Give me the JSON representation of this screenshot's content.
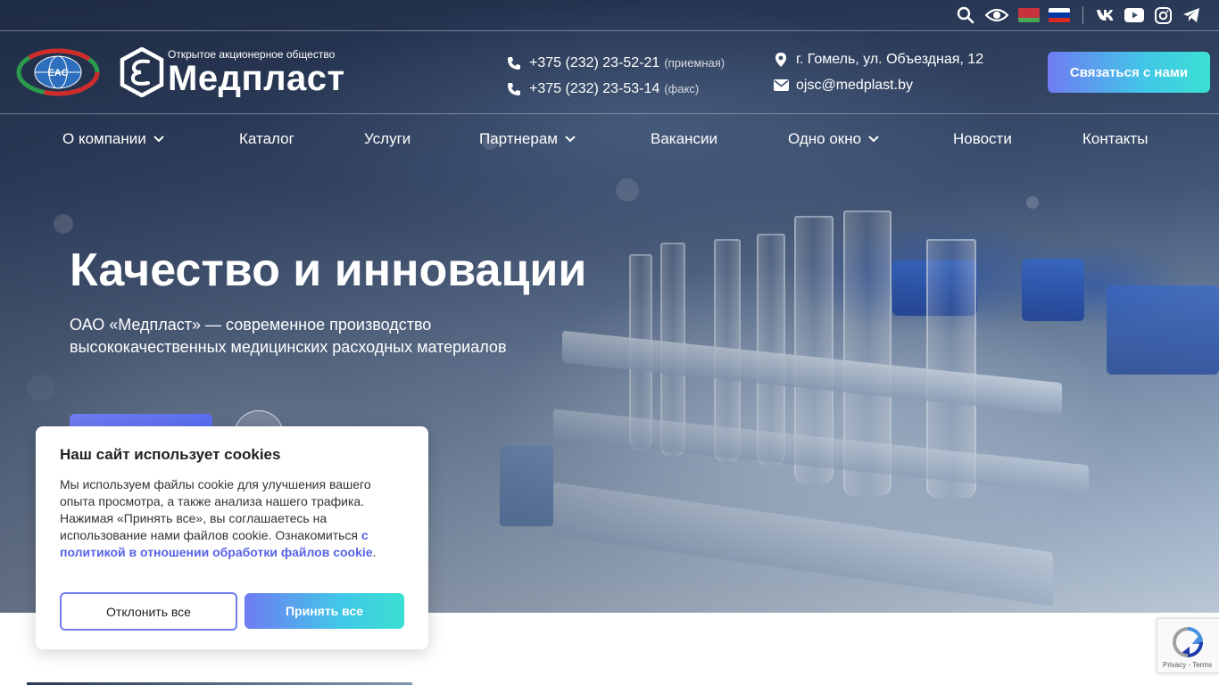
{
  "topbar": {
    "icons": [
      "search-icon",
      "eye-icon",
      "flag-by-icon",
      "flag-ru-icon",
      "vk-icon",
      "youtube-icon",
      "instagram-icon",
      "telegram-icon"
    ]
  },
  "header": {
    "eac_logo_text": "EAC",
    "brand_subtitle": "Открытое акционерное общество",
    "brand_name": "Медпласт",
    "phone1": "+375 (232) 23-52-21",
    "phone1_note": "(приемная)",
    "phone2": "+375 (232) 23-53-14",
    "phone2_note": "(факс)",
    "address": "г. Гомель, ул. Объездная, 12",
    "email": "ojsc@medplast.by",
    "cta_label": "Связаться с нами"
  },
  "nav": {
    "items": [
      {
        "label": "О компании",
        "has_dropdown": true
      },
      {
        "label": "Каталог",
        "has_dropdown": false
      },
      {
        "label": "Услуги",
        "has_dropdown": false
      },
      {
        "label": "Партнерам",
        "has_dropdown": true
      },
      {
        "label": "Вакансии",
        "has_dropdown": false
      },
      {
        "label": "Одно окно",
        "has_dropdown": true
      },
      {
        "label": "Новости",
        "has_dropdown": false
      },
      {
        "label": "Контакты",
        "has_dropdown": false
      }
    ]
  },
  "hero": {
    "title": "Качество и инновации",
    "subtitle": "ОАО «Медпласт» — современное производство высококачественных медицинских расходных материалов"
  },
  "cookie": {
    "title": "Наш сайт использует cookies",
    "text": "Мы используем файлы cookie для улучшения вашего опыта просмотра, а также анализа нашего трафика. Нажимая «Принять все», вы соглашаетесь на использование нами файлов cookie. Ознакомиться ",
    "link": "с политикой в отношении обработки файлов cookie",
    "text_end": ".",
    "decline_label": "Отклонить все",
    "accept_label": "Принять все"
  },
  "recaptcha": {
    "label": "Privacy - Terms"
  },
  "colors": {
    "accent_start": "#6f7cf2",
    "accent_end": "#3be0d2",
    "link": "#5563e6"
  }
}
